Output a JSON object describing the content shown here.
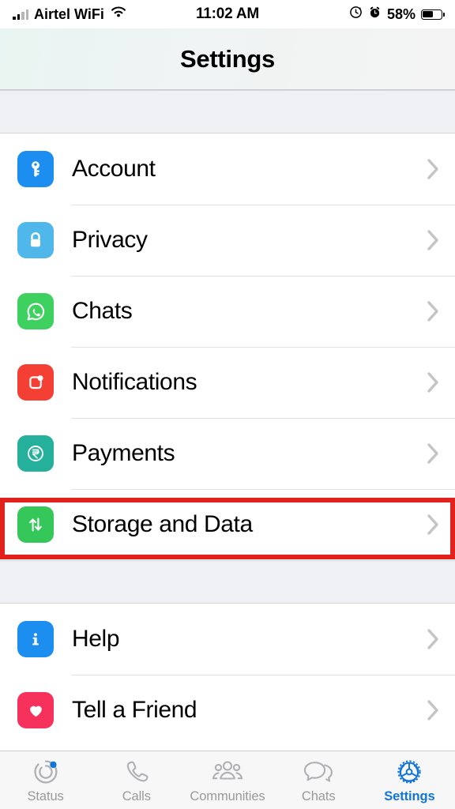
{
  "status_bar": {
    "carrier": "Airtel WiFi",
    "wifi_icon": "wifi-icon",
    "signal_icon": "cellular-signal-icon",
    "time": "11:02 AM",
    "rotation_lock_icon": "rotation-lock-icon",
    "alarm_icon": "alarm-clock-icon",
    "battery_percent": "58%",
    "battery_level": 58,
    "battery_icon": "battery-icon"
  },
  "header": {
    "title": "Settings"
  },
  "colors": {
    "accent": "#1275d8",
    "highlight_box": "#e1211b",
    "group_background": "#eff0f4",
    "separator": "#e2e2e4",
    "chevron": "#c4c4c6",
    "tab_inactive": "#9a9a9e"
  },
  "groups": [
    {
      "name": "primary-settings-group",
      "items": [
        {
          "label": "Account",
          "icon": "key-icon",
          "icon_color": "#1c8ef0",
          "chevron": "chevron-right-icon",
          "highlighted": false
        },
        {
          "label": "Privacy",
          "icon": "lock-icon",
          "icon_color": "#4fb7ea",
          "chevron": "chevron-right-icon",
          "highlighted": false
        },
        {
          "label": "Chats",
          "icon": "whatsapp-logo-icon",
          "icon_color": "#3ed160",
          "chevron": "chevron-right-icon",
          "highlighted": false
        },
        {
          "label": "Notifications",
          "icon": "notification-badge-icon",
          "icon_color": "#f43f35",
          "chevron": "chevron-right-icon",
          "highlighted": false
        },
        {
          "label": "Payments",
          "icon": "rupee-circle-icon",
          "icon_color": "#24b09b",
          "chevron": "chevron-right-icon",
          "highlighted": false
        },
        {
          "label": "Storage and Data",
          "icon": "arrows-up-down-icon",
          "icon_color": "#35c759",
          "chevron": "chevron-right-icon",
          "highlighted": true
        }
      ]
    },
    {
      "name": "secondary-settings-group",
      "items": [
        {
          "label": "Help",
          "icon": "info-icon",
          "icon_color": "#1c8ef0",
          "chevron": "chevron-right-icon",
          "highlighted": false
        },
        {
          "label": "Tell a Friend",
          "icon": "heart-icon",
          "icon_color": "#f6325c",
          "chevron": "chevron-right-icon",
          "highlighted": false
        }
      ]
    }
  ],
  "tabs": [
    {
      "label": "Status",
      "icon": "status-rings-icon",
      "active": false,
      "badge": true
    },
    {
      "label": "Calls",
      "icon": "phone-icon",
      "active": false,
      "badge": false
    },
    {
      "label": "Communities",
      "icon": "communities-icon",
      "active": false,
      "badge": false
    },
    {
      "label": "Chats",
      "icon": "chat-bubbles-icon",
      "active": false,
      "badge": false
    },
    {
      "label": "Settings",
      "icon": "gear-icon",
      "active": true,
      "badge": false
    }
  ]
}
